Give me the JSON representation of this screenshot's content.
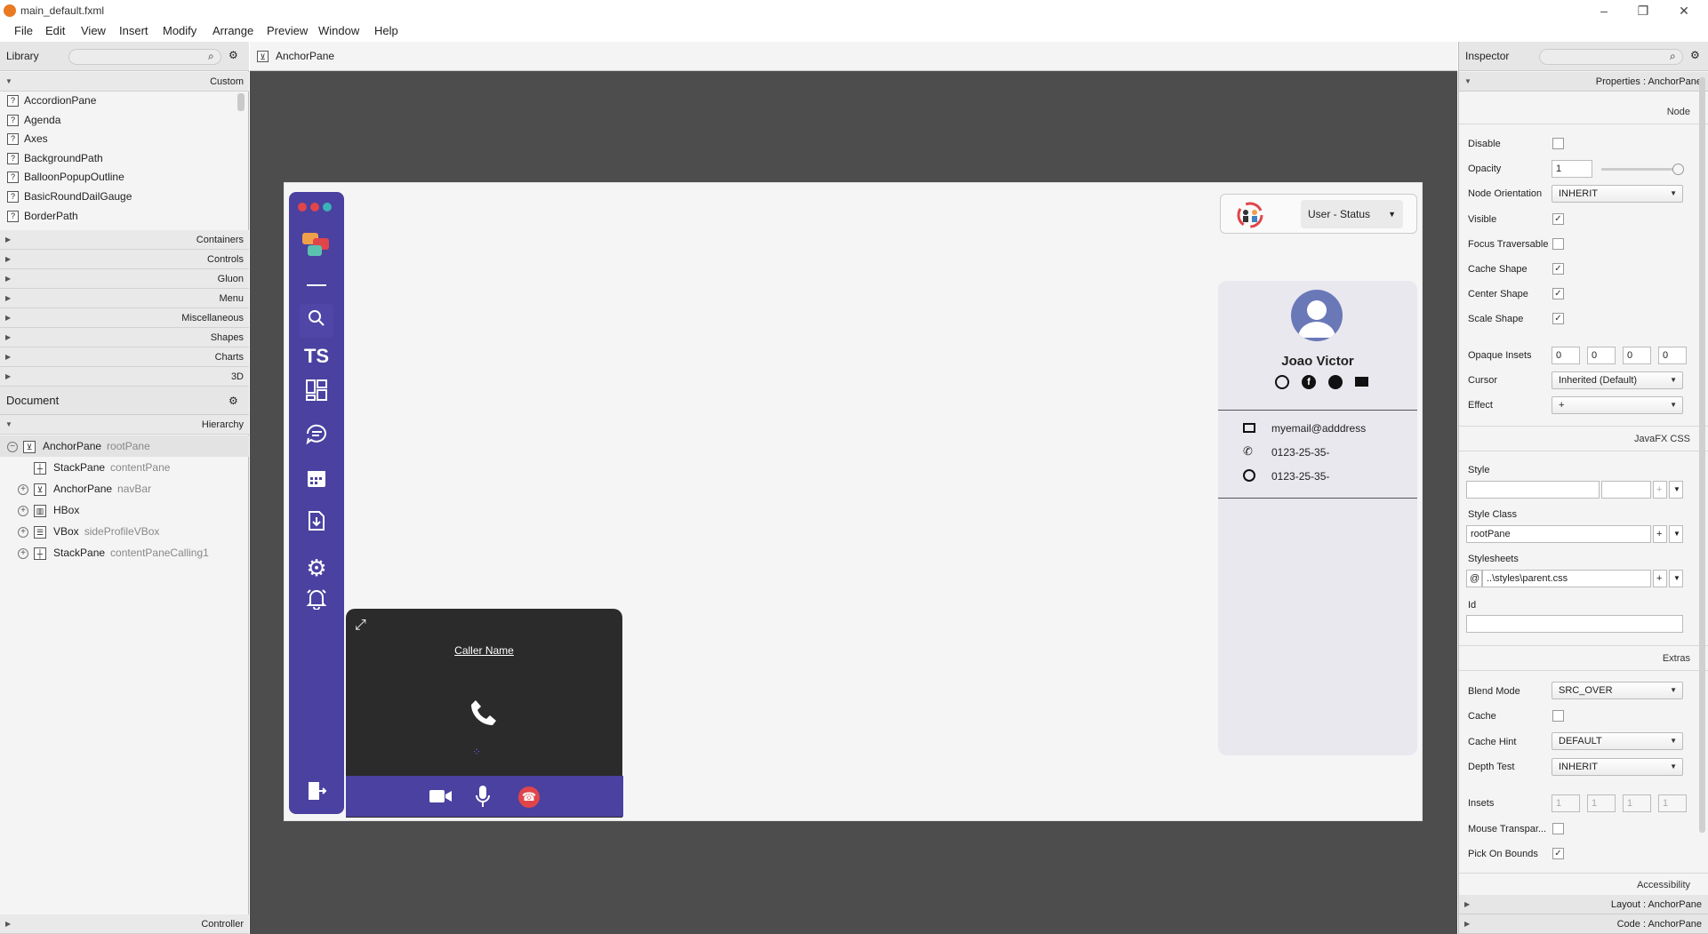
{
  "window": {
    "title": "main_default.fxml",
    "controls": [
      "minimize-icon",
      "restore-icon",
      "close-icon"
    ]
  },
  "menubar": [
    "File",
    "Edit",
    "View",
    "Insert",
    "Modify",
    "Arrange",
    "Preview",
    "Window",
    "Help"
  ],
  "library": {
    "title": "Library",
    "sections": {
      "custom": "Custom"
    },
    "items": [
      "AccordionPane",
      "Agenda",
      "Axes",
      "BackgroundPath",
      "BalloonPopupOutline",
      "BasicRoundDailGauge",
      "BorderPath"
    ],
    "categories": [
      "Containers",
      "Controls",
      "Gluon",
      "Menu",
      "Miscellaneous",
      "Shapes",
      "Charts",
      "3D"
    ]
  },
  "document": {
    "title": "Document",
    "hierarchy_label": "Hierarchy",
    "tree": [
      {
        "type": "AnchorPane",
        "id": "rootPane"
      },
      {
        "type": "StackPane",
        "id": "contentPane"
      },
      {
        "type": "AnchorPane",
        "id": "navBar"
      },
      {
        "type": "HBox",
        "id": ""
      },
      {
        "type": "VBox",
        "id": "sideProfileVBox"
      },
      {
        "type": "StackPane",
        "id": "contentPaneCalling1"
      }
    ],
    "controller": "Controller"
  },
  "editor": {
    "breadcrumb": "AnchorPane",
    "app": {
      "nav_logo": "TS",
      "user_status": "User - Status",
      "profile": {
        "name": "Joao Victor",
        "email": "myemail@adddress",
        "phone": "0123-25-35-",
        "whatsapp": "0123-25-35-"
      },
      "caller": {
        "name": "Caller Name"
      },
      "colors": {
        "nav": "#4a41a0",
        "caller_bg": "#2b2b2b",
        "hangup": "#e0454a"
      }
    }
  },
  "inspector": {
    "title": "Inspector",
    "properties_header": "Properties : AnchorPane",
    "node_label": "Node",
    "disable": "Disable",
    "opacity": "Opacity",
    "opacity_value": "1",
    "node_orientation": "Node Orientation",
    "node_orientation_value": "INHERIT",
    "visible": "Visible",
    "focus_traversable": "Focus Traversable",
    "cache_shape": "Cache Shape",
    "center_shape": "Center Shape",
    "scale_shape": "Scale Shape",
    "opaque_insets": "Opaque Insets",
    "opaque_values": [
      "0",
      "0",
      "0",
      "0"
    ],
    "cursor": "Cursor",
    "cursor_value": "Inherited (Default)",
    "effect": "Effect",
    "effect_value": "+",
    "javafx_css": "JavaFX CSS",
    "style": "Style",
    "style_class": "Style Class",
    "style_class_value": "rootPane",
    "stylesheets": "Stylesheets",
    "stylesheets_value": "..\\styles\\parent.css",
    "id": "Id",
    "extras": "Extras",
    "blend_mode": "Blend Mode",
    "blend_mode_value": "SRC_OVER",
    "cache": "Cache",
    "cache_hint": "Cache Hint",
    "cache_hint_value": "DEFAULT",
    "depth_test": "Depth Test",
    "depth_test_value": "INHERIT",
    "insets": "Insets",
    "insets_values": [
      "1",
      "1",
      "1",
      "1"
    ],
    "mouse_transparent": "Mouse Transpar...",
    "pick_on_bounds": "Pick On Bounds",
    "accessibility": "Accessibility",
    "layout_header": "Layout : AnchorPane",
    "code_header": "Code : AnchorPane"
  }
}
